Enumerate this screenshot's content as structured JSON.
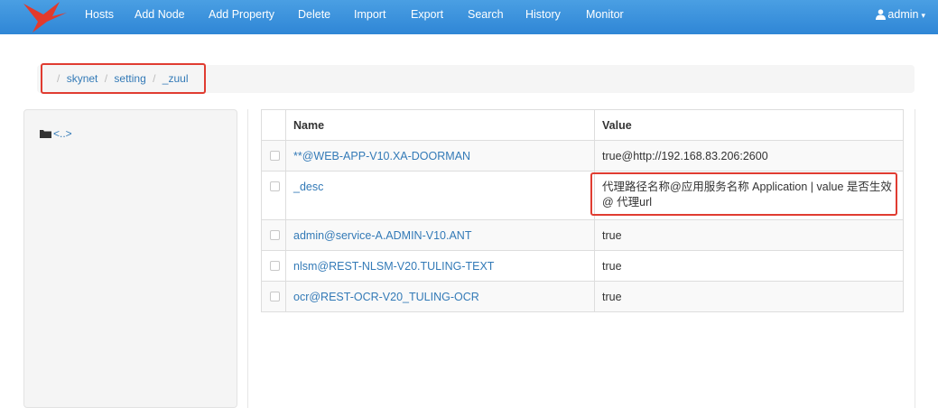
{
  "navbar": {
    "items": [
      "Hosts",
      "Add Node",
      "Add Property",
      "Delete",
      "Import",
      "Export",
      "Search",
      "History",
      "Monitor"
    ],
    "user": "admin",
    "color": "#3a92dd"
  },
  "breadcrumb": [
    "skynet",
    "setting",
    "_zuul"
  ],
  "sidebar": {
    "tree_item": "<..>"
  },
  "table": {
    "headers": {
      "name": "Name",
      "value": "Value"
    },
    "rows": [
      {
        "name": "**@WEB-APP-V10.XA-DOORMAN",
        "value": "true@http://192.168.83.206:2600"
      },
      {
        "name": "_desc",
        "value": "代理路径名称@应用服务名称 Application | value 是否生效@ 代理url"
      },
      {
        "name": "admin@service-A.ADMIN-V10.ANT",
        "value": "true"
      },
      {
        "name": "nlsm@REST-NLSM-V20.TULING-TEXT",
        "value": "true"
      },
      {
        "name": "ocr@REST-OCR-V20_TULING-OCR",
        "value": "true"
      }
    ]
  }
}
